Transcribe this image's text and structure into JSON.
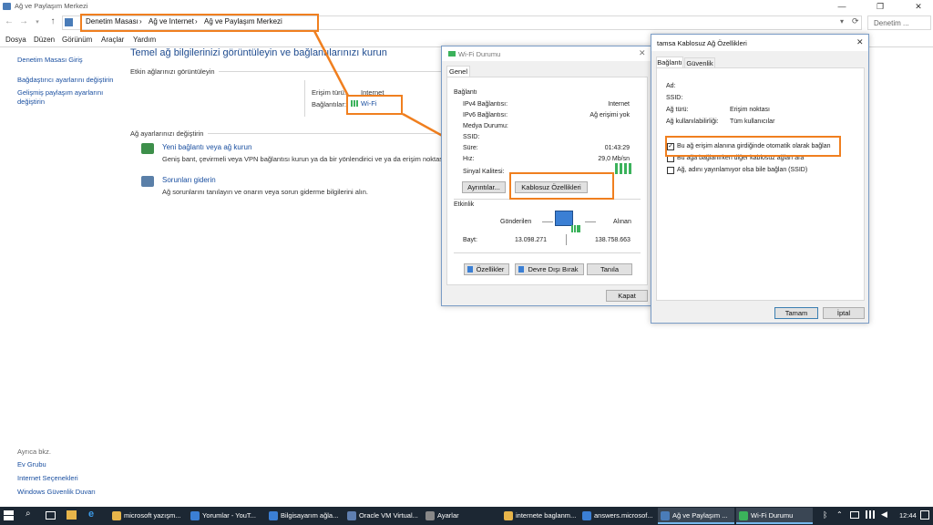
{
  "window": {
    "title": "Ağ ve Paylaşım Merkezi",
    "minimize": "—",
    "maximize": "❐",
    "close": "✕"
  },
  "address": {
    "crumbs": [
      "Denetim Masası",
      "Ağ ve Internet",
      "Ağ ve Paylaşım Merkezi"
    ],
    "sep": "›",
    "search_placeholder": "Denetim ..."
  },
  "menu": [
    "Dosya",
    "Düzen",
    "Görünüm",
    "Araçlar",
    "Yardım"
  ],
  "sidebar": {
    "top": [
      "Denetim Masası Giriş",
      "Bağdaştırıcı ayarlarını değiştirin",
      "Gelişmiş paylaşım ayarlarını",
      "değiştirin"
    ],
    "see_also": "Ayrıca bkz.",
    "bottom": [
      "Ev Grubu",
      "Internet Seçenekleri",
      "Windows Güvenlik Duvarı"
    ]
  },
  "main": {
    "heading": "Temel ağ bilgilerinizi görüntüleyin ve bağlantılarınızı kurun",
    "active_networks": "Etkin ağlarınızı görüntüleyin",
    "access_type_label": "Erişim türü:",
    "access_type_value": "Internet",
    "connections_label": "Bağlantılar:",
    "connections_value": "Wi-Fi",
    "change_settings": "Ağ ayarlarınızı değiştirin",
    "new_connection_title": "Yeni bağlantı veya ağ kurun",
    "new_connection_desc": "Geniş bant, çevirmeli veya VPN bağlantısı kurun ya da bir yönlendirici ve ya da erişim noktası a",
    "troubleshoot_title": "Sorunları giderin",
    "troubleshoot_desc": "Ağ sorunlarını tanılayın ve onarın veya sorun giderme bilgilerini alın."
  },
  "wifi_status": {
    "title": "Wi-Fi Durumu",
    "tab": "Genel",
    "connection_group": "Bağlantı",
    "rows": [
      {
        "label": "IPv4 Bağlantısı:",
        "value": "Internet"
      },
      {
        "label": "IPv6 Bağlantısı:",
        "value": "Ağ erişimi yok"
      },
      {
        "label": "Medya Durumu:",
        "value": ""
      },
      {
        "label": "SSID:",
        "value": ""
      },
      {
        "label": "Süre:",
        "value": "01:43:29"
      },
      {
        "label": "Hız:",
        "value": "29,0 Mb/sn"
      }
    ],
    "signal_label": "Sinyal Kalitesi:",
    "details_button": "Ayrıntılar...",
    "wireless_props_button": "Kablosuz Özellikleri",
    "activity_group": "Etkinlik",
    "sent_label": "Gönderilen",
    "received_label": "Alınan",
    "bytes_label": "Bayt:",
    "bytes_sent": "13.098.271",
    "bytes_received": "138.758.663",
    "properties_button": "Özellikler",
    "disable_button": "Devre Dışı Bırak",
    "diagnose_button": "Tanıla",
    "close_button": "Kapat"
  },
  "wireless_props": {
    "title": "tamsa Kablosuz Ağ Özellikleri",
    "tabs": [
      "Bağlantı",
      "Güvenlik"
    ],
    "rows": [
      {
        "label": "Ad:",
        "value": ""
      },
      {
        "label": "SSID:",
        "value": ""
      },
      {
        "label": "Ağ türü:",
        "value": "Erişim noktası"
      },
      {
        "label": "Ağ kullanılabilirliği:",
        "value": "Tüm kullanıcılar"
      }
    ],
    "checkboxes": [
      {
        "label": "Bu ağ erişim alanına girdiğinde otomatik olarak bağlan",
        "checked": true
      },
      {
        "label": "Bu ağa bağlanırken diğer kablosuz ağları ara",
        "checked": false
      },
      {
        "label": "Ağ, adını yayınlamıyor olsa bile bağlan (SSID)",
        "checked": false
      }
    ],
    "ok_button": "Tamam",
    "cancel_button": "İptal"
  },
  "taskbar": {
    "items": [
      {
        "label": "microsoft yazışm...",
        "color": "#e8b54a"
      },
      {
        "label": "Yorumlar - YouT...",
        "color": "#3b7fd4"
      },
      {
        "label": "Bilgisayarım ağla...",
        "color": "#3b7fd4"
      },
      {
        "label": "Oracle VM Virtual...",
        "color": "#5f7fb0"
      },
      {
        "label": "Ayarlar",
        "color": "#888888"
      },
      {
        "label": "internete baglanm...",
        "color": "#e8b54a"
      },
      {
        "label": "answers.microsof...",
        "color": "#3b7fd4"
      },
      {
        "label": "Ağ ve Paylaşım ...",
        "color": "#4a7cb8"
      },
      {
        "label": "Wi-Fi Durumu",
        "color": "#3bb25b"
      }
    ],
    "clock": "12:44"
  }
}
